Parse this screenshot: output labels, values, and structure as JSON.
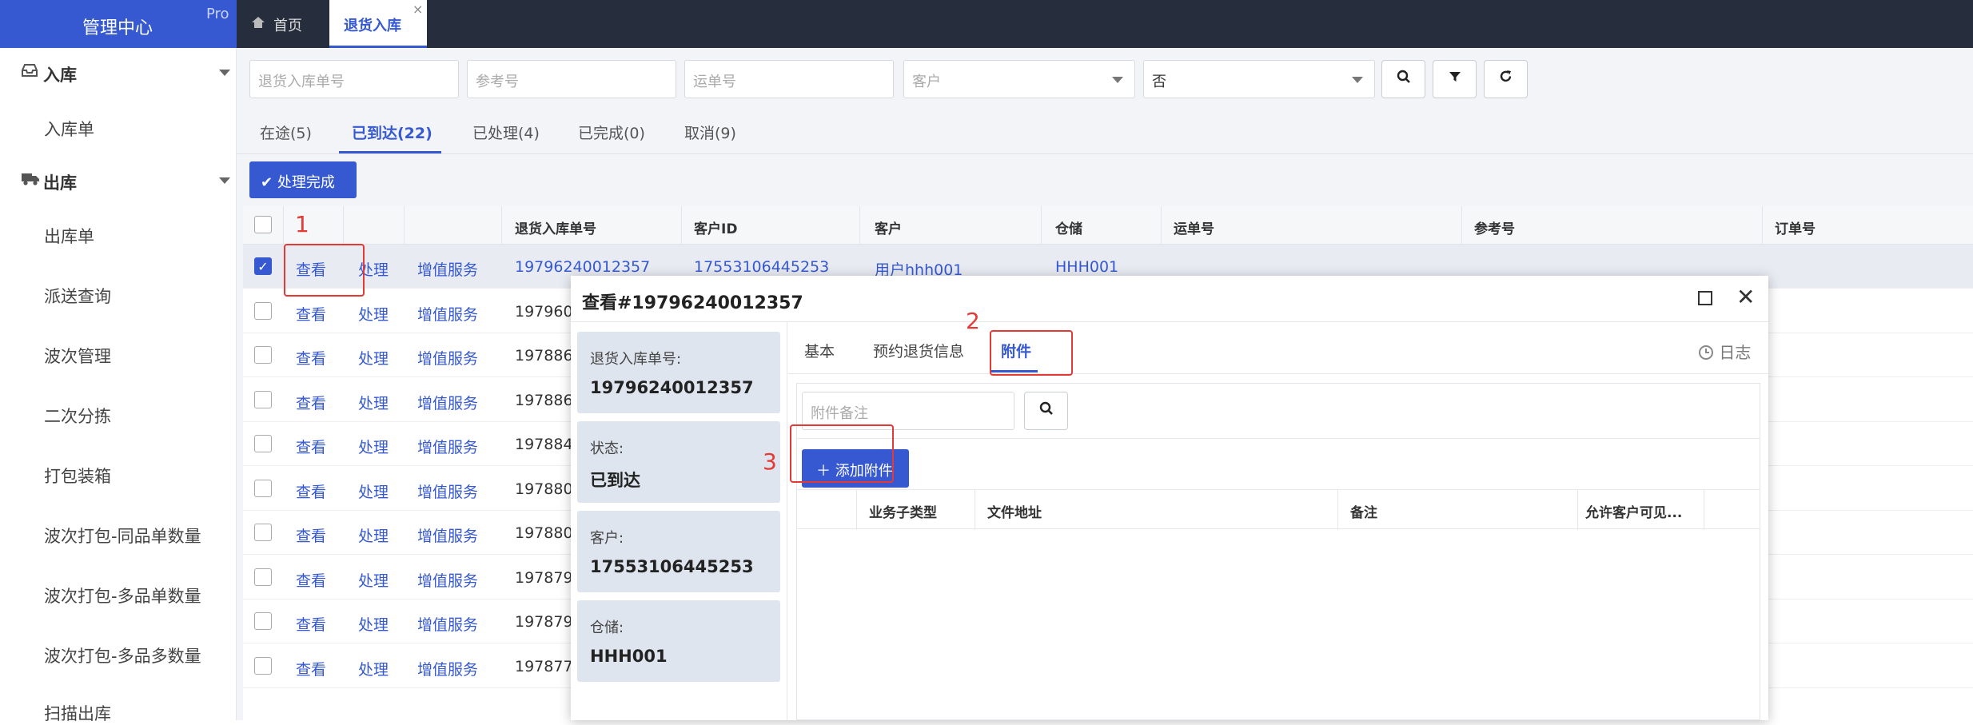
{
  "brand": {
    "title": "管理中心",
    "badge": "Pro"
  },
  "top_tabs": {
    "home": "首页",
    "return": "退货入库",
    "close": "×",
    "home_icon": "home-icon"
  },
  "sidebar": {
    "groups": [
      {
        "icon": "inbox-icon",
        "label": "入库",
        "items": [
          "入库单"
        ]
      },
      {
        "icon": "truck-icon",
        "label": "出库",
        "items": [
          "出库单",
          "派送查询",
          "波次管理",
          "二次分拣",
          "打包装箱",
          "波次打包-同品单数量",
          "波次打包-多品单数量",
          "波次打包-多品多数量",
          "扫描出库"
        ]
      }
    ]
  },
  "filters": {
    "return_no": "退货入库单号",
    "ref_no": "参考号",
    "waybill": "运单号",
    "customer": "客户",
    "flag_value": "否"
  },
  "status_tabs": [
    "在途(5)",
    "已到达(22)",
    "已处理(4)",
    "已完成(0)",
    "取消(9)"
  ],
  "active_status_tab": 1,
  "actions": {
    "done": "处理完成"
  },
  "table": {
    "headers": [
      "退货入库单号",
      "客户ID",
      "客户",
      "仓储",
      "运单号",
      "参考号",
      "订单号"
    ],
    "row_actions": {
      "view": "查看",
      "process": "处理",
      "vas": "增值服务"
    },
    "rows": [
      {
        "no": "19796240012357",
        "cid": "17553106445253",
        "cust": "用户hhh001",
        "wh": "HHH001",
        "checked": true
      },
      {
        "no": "197960",
        "checked": false
      },
      {
        "no": "197886",
        "checked": false
      },
      {
        "no": "197886",
        "checked": false
      },
      {
        "no": "197884",
        "checked": false
      },
      {
        "no": "197880",
        "checked": false
      },
      {
        "no": "197880",
        "checked": false
      },
      {
        "no": "197879",
        "checked": false
      },
      {
        "no": "197879",
        "checked": false
      },
      {
        "no": "197877",
        "checked": false
      }
    ]
  },
  "modal": {
    "title": "查看#19796240012357",
    "cards": [
      {
        "label": "退货入库单号:",
        "value": "19796240012357"
      },
      {
        "label": "状态:",
        "value": "已到达"
      },
      {
        "label": "客户:",
        "value": "17553106445253"
      },
      {
        "label": "仓储:",
        "value": "HHH001"
      }
    ],
    "tabs": [
      "基本",
      "预约退货信息",
      "附件"
    ],
    "active_tab": 2,
    "log": "日志",
    "attachment": {
      "remark_placeholder": "附件备注",
      "add_label": "添加附件",
      "headers": [
        "业务子类型",
        "文件地址",
        "备注",
        "允许客户可见..."
      ]
    }
  },
  "annotations": [
    "1",
    "2",
    "3"
  ],
  "colors": {
    "accent": "#3659d2",
    "topbar": "#262d3d",
    "annotation": "#e53935"
  }
}
